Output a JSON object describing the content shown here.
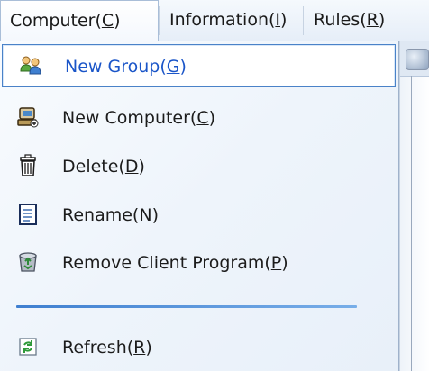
{
  "menubar": {
    "items": [
      {
        "label": "Computer(",
        "mnemonic": "C",
        "suffix": ")"
      },
      {
        "label": "Information(",
        "mnemonic": "I",
        "suffix": ")"
      },
      {
        "label": "Rules(",
        "mnemonic": "R",
        "suffix": ")"
      }
    ]
  },
  "menu": {
    "items": [
      {
        "prefix": "New Group(",
        "mnemonic": "G",
        "suffix": ")",
        "icon": "group-icon",
        "highlighted": true
      },
      {
        "prefix": "New Computer(",
        "mnemonic": "C",
        "suffix": ")",
        "icon": "computer-icon"
      },
      {
        "prefix": "Delete(",
        "mnemonic": "D",
        "suffix": ")",
        "icon": "trash-icon"
      },
      {
        "prefix": "Rename(",
        "mnemonic": "N",
        "suffix": ")",
        "icon": "document-icon"
      },
      {
        "prefix": "Remove Client Program(",
        "mnemonic": "P",
        "suffix": ")",
        "icon": "recycle-icon"
      },
      {
        "prefix": "Refresh(",
        "mnemonic": "R",
        "suffix": ")",
        "icon": "refresh-icon"
      }
    ]
  },
  "colors": {
    "highlight_border": "#4a82c8",
    "highlight_text": "#1a55c8",
    "divider": "#3f7fd0"
  }
}
